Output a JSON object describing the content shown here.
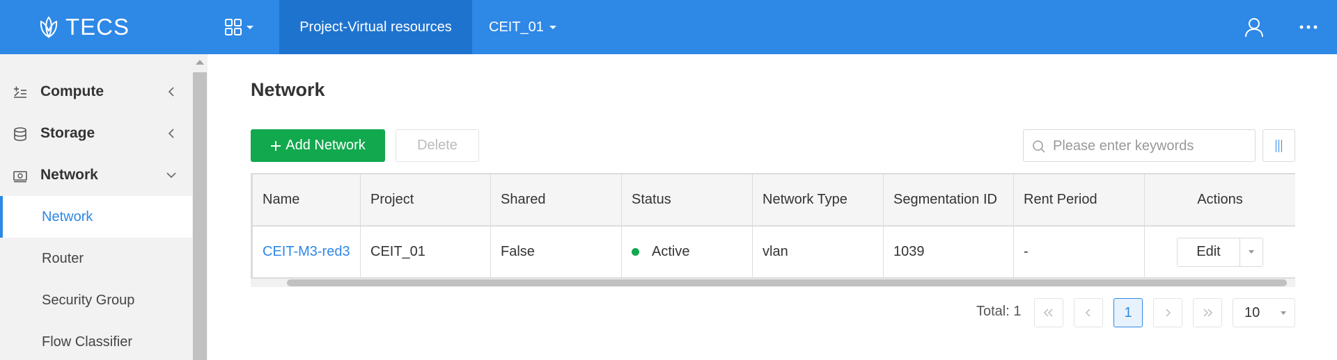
{
  "topbar": {
    "logo_text": "TECS",
    "active_tab": "Project-Virtual resources",
    "project_selector": "CEIT_01",
    "bar_color": "#2e88e6"
  },
  "sidebar": {
    "groups": [
      {
        "label": "Compute",
        "icon": "compute-icon",
        "expanded": false
      },
      {
        "label": "Storage",
        "icon": "storage-icon",
        "expanded": false
      },
      {
        "label": "Network",
        "icon": "network-icon",
        "expanded": true
      }
    ],
    "items": [
      {
        "label": "Network",
        "active": true
      },
      {
        "label": "Router",
        "active": false
      },
      {
        "label": "Security Group",
        "active": false
      },
      {
        "label": "Flow Classifier",
        "active": false
      }
    ]
  },
  "main": {
    "title": "Network",
    "add_button": "Add Network",
    "delete_button": "Delete",
    "search_placeholder": "Please enter keywords"
  },
  "table": {
    "columns": [
      "Name",
      "Project",
      "Shared",
      "Status",
      "Network Type",
      "Segmentation ID",
      "Rent Period",
      "Actions"
    ],
    "rows": [
      {
        "name": "CEIT-M3-red3",
        "project": "CEIT_01",
        "shared": "False",
        "status": "Active",
        "network_type": "vlan",
        "segmentation_id": "1039",
        "rent_period": "-",
        "action": "Edit"
      }
    ]
  },
  "pagination": {
    "total_label": "Total: 1",
    "current_page": "1",
    "page_size": "10"
  },
  "colors": {
    "accent": "#2e88e6",
    "add_button": "#12a84e",
    "status_active": "#12a84e"
  }
}
